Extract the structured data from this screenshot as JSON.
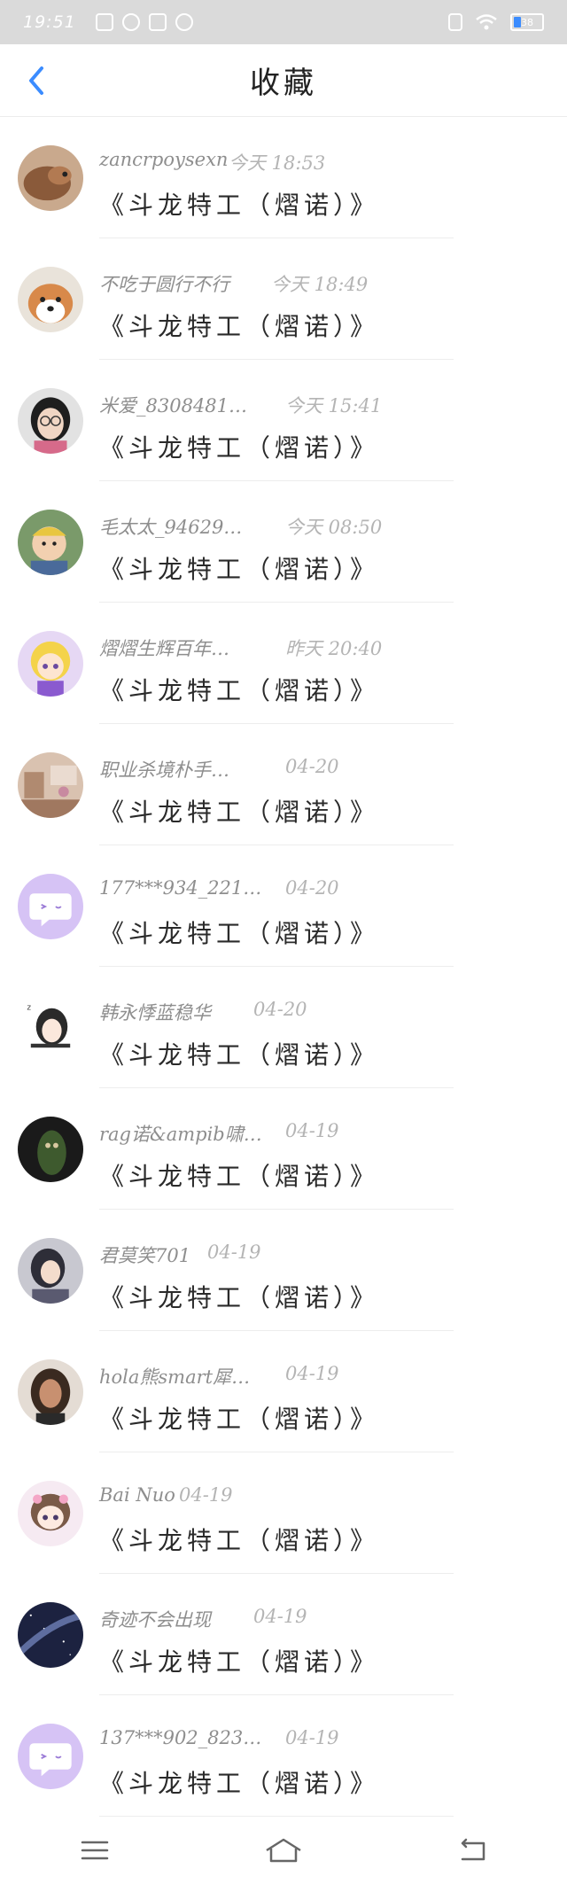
{
  "status_bar": {
    "time": "19:51",
    "battery": "38"
  },
  "header": {
    "title": "收藏"
  },
  "title_text": "《斗龙特工（熠诺）》",
  "items": [
    {
      "name": "zancrpoysexn",
      "time": "今天 18:53",
      "avatar": "dog-brown"
    },
    {
      "name": "不吃于圆行不行",
      "time": "今天 18:49",
      "avatar": "dog-shiba"
    },
    {
      "name": "米爱_8308481…",
      "time": "今天 15:41",
      "avatar": "girl-glasses"
    },
    {
      "name": "毛太太_94629…",
      "time": "今天 08:50",
      "avatar": "baby"
    },
    {
      "name": "熠熠生辉百年…",
      "time": "昨天 20:40",
      "avatar": "anime-girl"
    },
    {
      "name": "职业杀境朴手…",
      "time": "04-20",
      "avatar": "room"
    },
    {
      "name": "177***934_221…",
      "time": "04-20",
      "avatar": "default-purple"
    },
    {
      "name": "韩永悸蓝稳华",
      "time": "04-20",
      "avatar": "sketch-girl"
    },
    {
      "name": "rag诺&ampib啸…",
      "time": "04-19",
      "avatar": "dark-figure"
    },
    {
      "name": "君莫笑701",
      "time": "04-19",
      "avatar": "portrait-dark"
    },
    {
      "name": "hola熊smart犀…",
      "time": "04-19",
      "avatar": "girl-photo"
    },
    {
      "name": "Bai Nuo",
      "time": "04-19",
      "avatar": "anime-cute"
    },
    {
      "name": "奇迹不会出现",
      "time": "04-19",
      "avatar": "galaxy"
    },
    {
      "name": "137***902_823…",
      "time": "04-19",
      "avatar": "default-purple"
    }
  ],
  "time_offsets": [
    258,
    306,
    322,
    322,
    322,
    322,
    322,
    286,
    322,
    234,
    322,
    202,
    286,
    322
  ],
  "colors": {
    "accent": "#3b8cff",
    "default_avatar": "#d8c4f5"
  },
  "nav": {
    "items": [
      "menu-icon",
      "home-icon",
      "back-icon"
    ]
  }
}
